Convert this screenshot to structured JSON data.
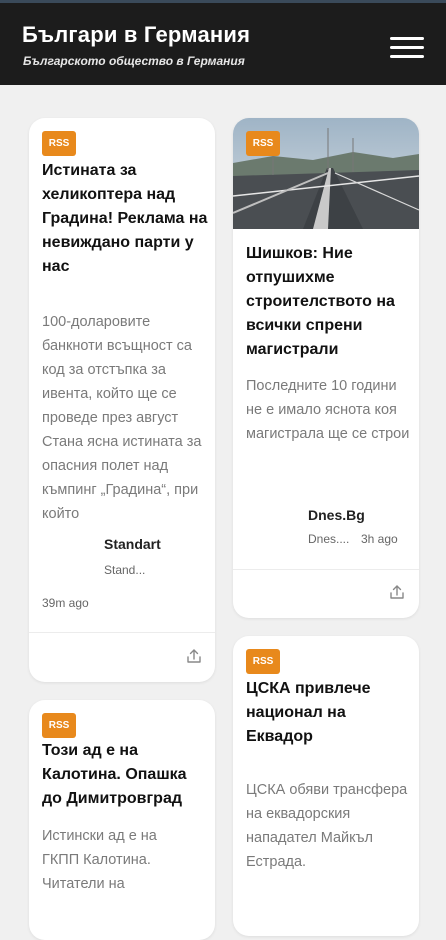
{
  "header": {
    "title": "Българи в Германия",
    "subtitle": "Българското общество в Германия"
  },
  "cards": [
    {
      "badge": "RSS",
      "title": "Истината за хеликоптера над Градина! Реклама на невиждано парти у нас",
      "summary": "100-доларовите банкноти всъщност са код за отстъпка за ивента, който ще се проведе през август Стана ясна истината за опасния полет над къмпинг „Градина“, при който",
      "source": "Standart",
      "source_short": "Stand...",
      "time": "39m ago"
    },
    {
      "badge": "RSS",
      "title": "Шишков: Ние отпушихме строителството на всички спрени магистрали",
      "summary": "Последните 10 години не е имало яснота коя магистрала ще се строи",
      "source": "Dnes.Bg",
      "source_short": "Dnes....",
      "time": "3h ago"
    },
    {
      "badge": "RSS",
      "title": "ЦСКА привлече национал на Еквадор",
      "summary": "ЦСКА обяви трансфера на еквадорския нападател Майкъл Естрада."
    },
    {
      "badge": "RSS",
      "title": "Този ад е на Калотина. Опашка до Димитровград",
      "summary": "Истински ад е на ГКПП Калотина. Читатели на"
    }
  ],
  "icons": {
    "menu": "hamburger-menu-icon",
    "share": "share-icon"
  },
  "colors": {
    "header_bg": "#1c1c1c",
    "badge": "#e8891c",
    "page_bg": "#f0f0f0"
  }
}
